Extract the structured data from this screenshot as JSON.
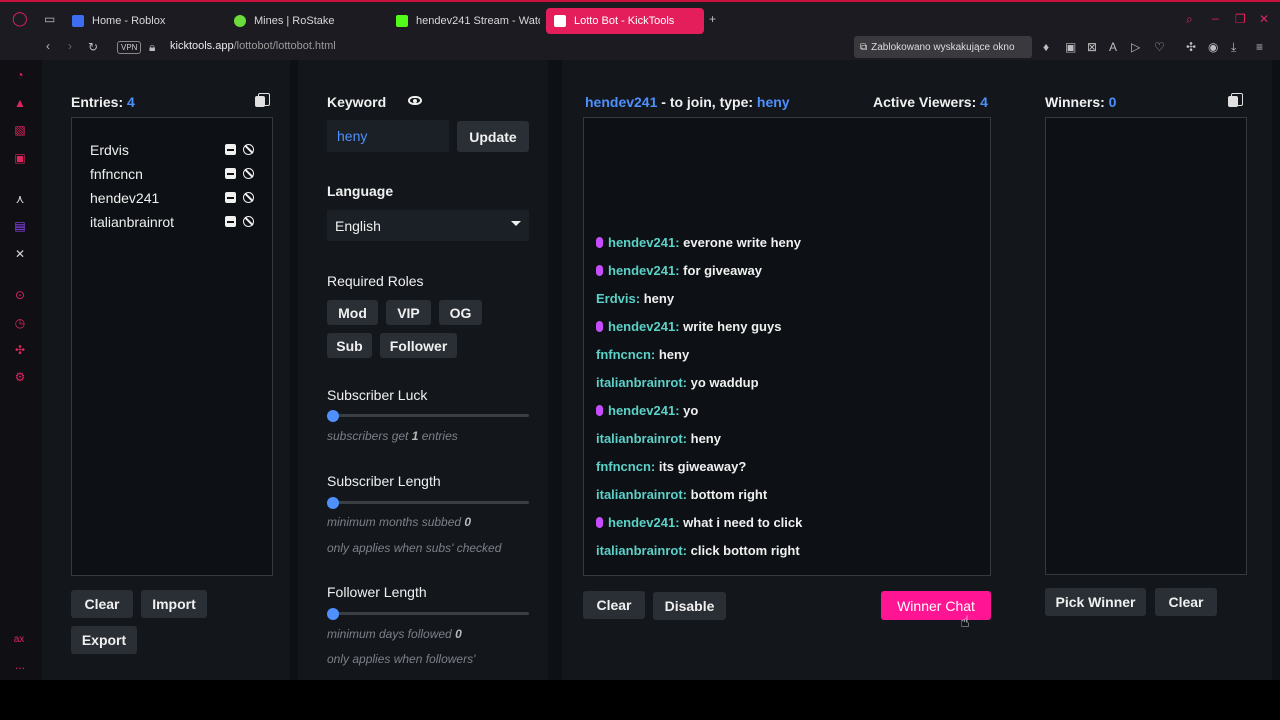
{
  "browser": {
    "tabs": [
      {
        "label": "Home - Roblox",
        "color": "#3d6df0"
      },
      {
        "label": "Mines | RoStake",
        "color": "#6bdc3a"
      },
      {
        "label": "hendev241 Stream - Watc",
        "color": "#53fc18"
      },
      {
        "label": "Lotto Bot - KickTools",
        "color": "#e31e5a"
      }
    ],
    "vpn_label": "VPN",
    "url_host": "kicktools.app",
    "url_path": "/lottobot/lottobot.html",
    "popup_blocked": "Zablokowano wyskakujące okno"
  },
  "sidebar": {
    "bottom_label": "ax",
    "more": "..."
  },
  "entries": {
    "title": "Entries:",
    "count": "4",
    "list": [
      "Erdvis",
      "fnfncncn",
      "hendev241",
      "italianbrainrot"
    ],
    "clear_label": "Clear",
    "import_label": "Import",
    "export_label": "Export"
  },
  "settings": {
    "keyword_label": "Keyword",
    "keyword_value": "heny",
    "update_label": "Update",
    "language_label": "Language",
    "language_value": "English",
    "roles_label": "Required Roles",
    "roles": [
      "Mod",
      "VIP",
      "OG",
      "Sub",
      "Follower"
    ],
    "sub_luck_label": "Subscriber Luck",
    "sub_luck_hint_pre": "subscribers get",
    "sub_luck_value": "1",
    "sub_luck_hint_post": "entries",
    "sub_length_label": "Subscriber Length",
    "sub_length_hint_pre": "minimum months subbed",
    "sub_length_value": "0",
    "sub_length_hint2": "only applies when subs' checked",
    "follower_length_label": "Follower Length",
    "follower_length_hint_pre": "minimum days followed",
    "follower_length_value": "0",
    "follower_length_hint2": "only applies when followers'"
  },
  "chat": {
    "channel": "hendev241",
    "join_text": "- to join, type:",
    "keyword": "heny",
    "active_label": "Active Viewers:",
    "active_count": "4",
    "messages": [
      {
        "user": "hendev241:",
        "text": "everone write heny",
        "mic": true
      },
      {
        "user": "hendev241:",
        "text": "for giveaway",
        "mic": true
      },
      {
        "user": "Erdvis:",
        "text": "heny",
        "mic": false
      },
      {
        "user": "hendev241:",
        "text": "write heny guys",
        "mic": true
      },
      {
        "user": "fnfncncn:",
        "text": "heny",
        "mic": false
      },
      {
        "user": "italianbrainrot:",
        "text": "yo waddup",
        "mic": false
      },
      {
        "user": "hendev241:",
        "text": "yo",
        "mic": true
      },
      {
        "user": "italianbrainrot:",
        "text": "heny",
        "mic": false
      },
      {
        "user": "fnfncncn:",
        "text": "its giweaway?",
        "mic": false
      },
      {
        "user": "italianbrainrot:",
        "text": "bottom right",
        "mic": false
      },
      {
        "user": "hendev241:",
        "text": "what i need to click",
        "mic": true
      },
      {
        "user": "italianbrainrot:",
        "text": "click bottom right",
        "mic": false
      }
    ],
    "clear_label": "Clear",
    "disable_label": "Disable",
    "winner_chat_label": "Winner Chat"
  },
  "winners": {
    "title": "Winners:",
    "count": "0",
    "pick_label": "Pick Winner",
    "clear_label": "Clear"
  }
}
